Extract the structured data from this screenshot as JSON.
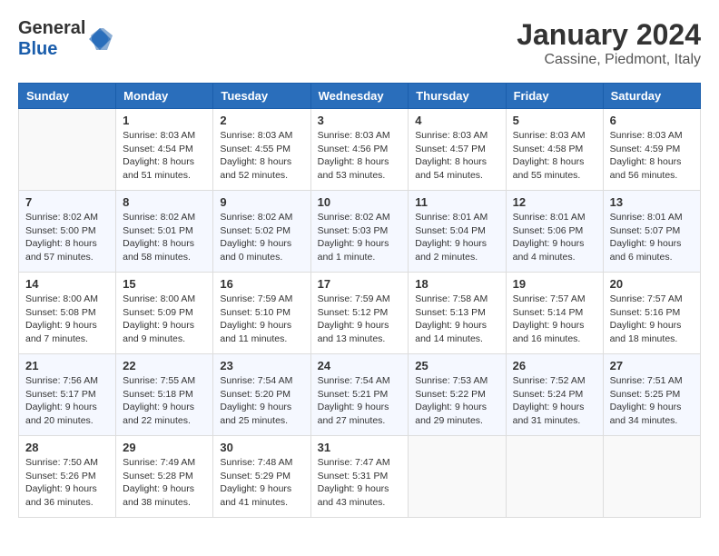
{
  "header": {
    "logo_general": "General",
    "logo_blue": "Blue",
    "month_year": "January 2024",
    "location": "Cassine, Piedmont, Italy"
  },
  "days_of_week": [
    "Sunday",
    "Monday",
    "Tuesday",
    "Wednesday",
    "Thursday",
    "Friday",
    "Saturday"
  ],
  "weeks": [
    [
      {
        "day": "",
        "info": ""
      },
      {
        "day": "1",
        "info": "Sunrise: 8:03 AM\nSunset: 4:54 PM\nDaylight: 8 hours\nand 51 minutes."
      },
      {
        "day": "2",
        "info": "Sunrise: 8:03 AM\nSunset: 4:55 PM\nDaylight: 8 hours\nand 52 minutes."
      },
      {
        "day": "3",
        "info": "Sunrise: 8:03 AM\nSunset: 4:56 PM\nDaylight: 8 hours\nand 53 minutes."
      },
      {
        "day": "4",
        "info": "Sunrise: 8:03 AM\nSunset: 4:57 PM\nDaylight: 8 hours\nand 54 minutes."
      },
      {
        "day": "5",
        "info": "Sunrise: 8:03 AM\nSunset: 4:58 PM\nDaylight: 8 hours\nand 55 minutes."
      },
      {
        "day": "6",
        "info": "Sunrise: 8:03 AM\nSunset: 4:59 PM\nDaylight: 8 hours\nand 56 minutes."
      }
    ],
    [
      {
        "day": "7",
        "info": "Sunrise: 8:02 AM\nSunset: 5:00 PM\nDaylight: 8 hours\nand 57 minutes."
      },
      {
        "day": "8",
        "info": "Sunrise: 8:02 AM\nSunset: 5:01 PM\nDaylight: 8 hours\nand 58 minutes."
      },
      {
        "day": "9",
        "info": "Sunrise: 8:02 AM\nSunset: 5:02 PM\nDaylight: 9 hours\nand 0 minutes."
      },
      {
        "day": "10",
        "info": "Sunrise: 8:02 AM\nSunset: 5:03 PM\nDaylight: 9 hours\nand 1 minute."
      },
      {
        "day": "11",
        "info": "Sunrise: 8:01 AM\nSunset: 5:04 PM\nDaylight: 9 hours\nand 2 minutes."
      },
      {
        "day": "12",
        "info": "Sunrise: 8:01 AM\nSunset: 5:06 PM\nDaylight: 9 hours\nand 4 minutes."
      },
      {
        "day": "13",
        "info": "Sunrise: 8:01 AM\nSunset: 5:07 PM\nDaylight: 9 hours\nand 6 minutes."
      }
    ],
    [
      {
        "day": "14",
        "info": "Sunrise: 8:00 AM\nSunset: 5:08 PM\nDaylight: 9 hours\nand 7 minutes."
      },
      {
        "day": "15",
        "info": "Sunrise: 8:00 AM\nSunset: 5:09 PM\nDaylight: 9 hours\nand 9 minutes."
      },
      {
        "day": "16",
        "info": "Sunrise: 7:59 AM\nSunset: 5:10 PM\nDaylight: 9 hours\nand 11 minutes."
      },
      {
        "day": "17",
        "info": "Sunrise: 7:59 AM\nSunset: 5:12 PM\nDaylight: 9 hours\nand 13 minutes."
      },
      {
        "day": "18",
        "info": "Sunrise: 7:58 AM\nSunset: 5:13 PM\nDaylight: 9 hours\nand 14 minutes."
      },
      {
        "day": "19",
        "info": "Sunrise: 7:57 AM\nSunset: 5:14 PM\nDaylight: 9 hours\nand 16 minutes."
      },
      {
        "day": "20",
        "info": "Sunrise: 7:57 AM\nSunset: 5:16 PM\nDaylight: 9 hours\nand 18 minutes."
      }
    ],
    [
      {
        "day": "21",
        "info": "Sunrise: 7:56 AM\nSunset: 5:17 PM\nDaylight: 9 hours\nand 20 minutes."
      },
      {
        "day": "22",
        "info": "Sunrise: 7:55 AM\nSunset: 5:18 PM\nDaylight: 9 hours\nand 22 minutes."
      },
      {
        "day": "23",
        "info": "Sunrise: 7:54 AM\nSunset: 5:20 PM\nDaylight: 9 hours\nand 25 minutes."
      },
      {
        "day": "24",
        "info": "Sunrise: 7:54 AM\nSunset: 5:21 PM\nDaylight: 9 hours\nand 27 minutes."
      },
      {
        "day": "25",
        "info": "Sunrise: 7:53 AM\nSunset: 5:22 PM\nDaylight: 9 hours\nand 29 minutes."
      },
      {
        "day": "26",
        "info": "Sunrise: 7:52 AM\nSunset: 5:24 PM\nDaylight: 9 hours\nand 31 minutes."
      },
      {
        "day": "27",
        "info": "Sunrise: 7:51 AM\nSunset: 5:25 PM\nDaylight: 9 hours\nand 34 minutes."
      }
    ],
    [
      {
        "day": "28",
        "info": "Sunrise: 7:50 AM\nSunset: 5:26 PM\nDaylight: 9 hours\nand 36 minutes."
      },
      {
        "day": "29",
        "info": "Sunrise: 7:49 AM\nSunset: 5:28 PM\nDaylight: 9 hours\nand 38 minutes."
      },
      {
        "day": "30",
        "info": "Sunrise: 7:48 AM\nSunset: 5:29 PM\nDaylight: 9 hours\nand 41 minutes."
      },
      {
        "day": "31",
        "info": "Sunrise: 7:47 AM\nSunset: 5:31 PM\nDaylight: 9 hours\nand 43 minutes."
      },
      {
        "day": "",
        "info": ""
      },
      {
        "day": "",
        "info": ""
      },
      {
        "day": "",
        "info": ""
      }
    ]
  ]
}
